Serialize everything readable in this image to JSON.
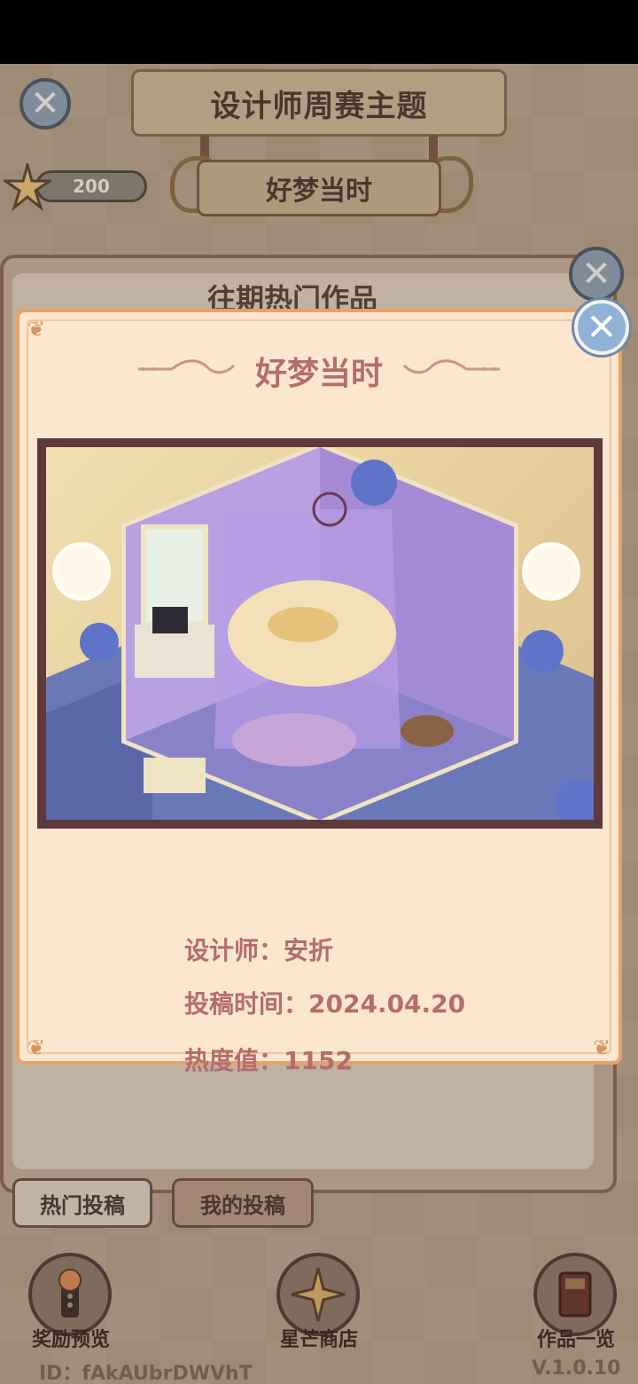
{
  "header": {
    "title": "设计师周赛主题",
    "theme": "好梦当时",
    "stars": "200"
  },
  "back_panel": {
    "title": "往期热门作品"
  },
  "tabs": [
    {
      "label": "热门投稿"
    },
    {
      "label": "我的投稿"
    }
  ],
  "bottom_nav": [
    {
      "label": "奖励预览",
      "icon": "reward-preview-icon"
    },
    {
      "label": "星芒商店",
      "icon": "star-shop-icon"
    },
    {
      "label": "作品一览",
      "icon": "works-book-icon"
    }
  ],
  "footer": {
    "id": "ID：fAkAUbrDWVhT",
    "version": "V.1.0.10"
  },
  "modal": {
    "title": "好梦当时",
    "designer": "设计师：安折",
    "submit_time": "投稿时间：2024.04.20",
    "heat": "热度值：1152"
  },
  "colors": {
    "modal_bg": "#fbe6cf",
    "modal_border": "#e5a36a",
    "modal_text": "#b36d6d",
    "close_button": "#8fb2d6"
  }
}
